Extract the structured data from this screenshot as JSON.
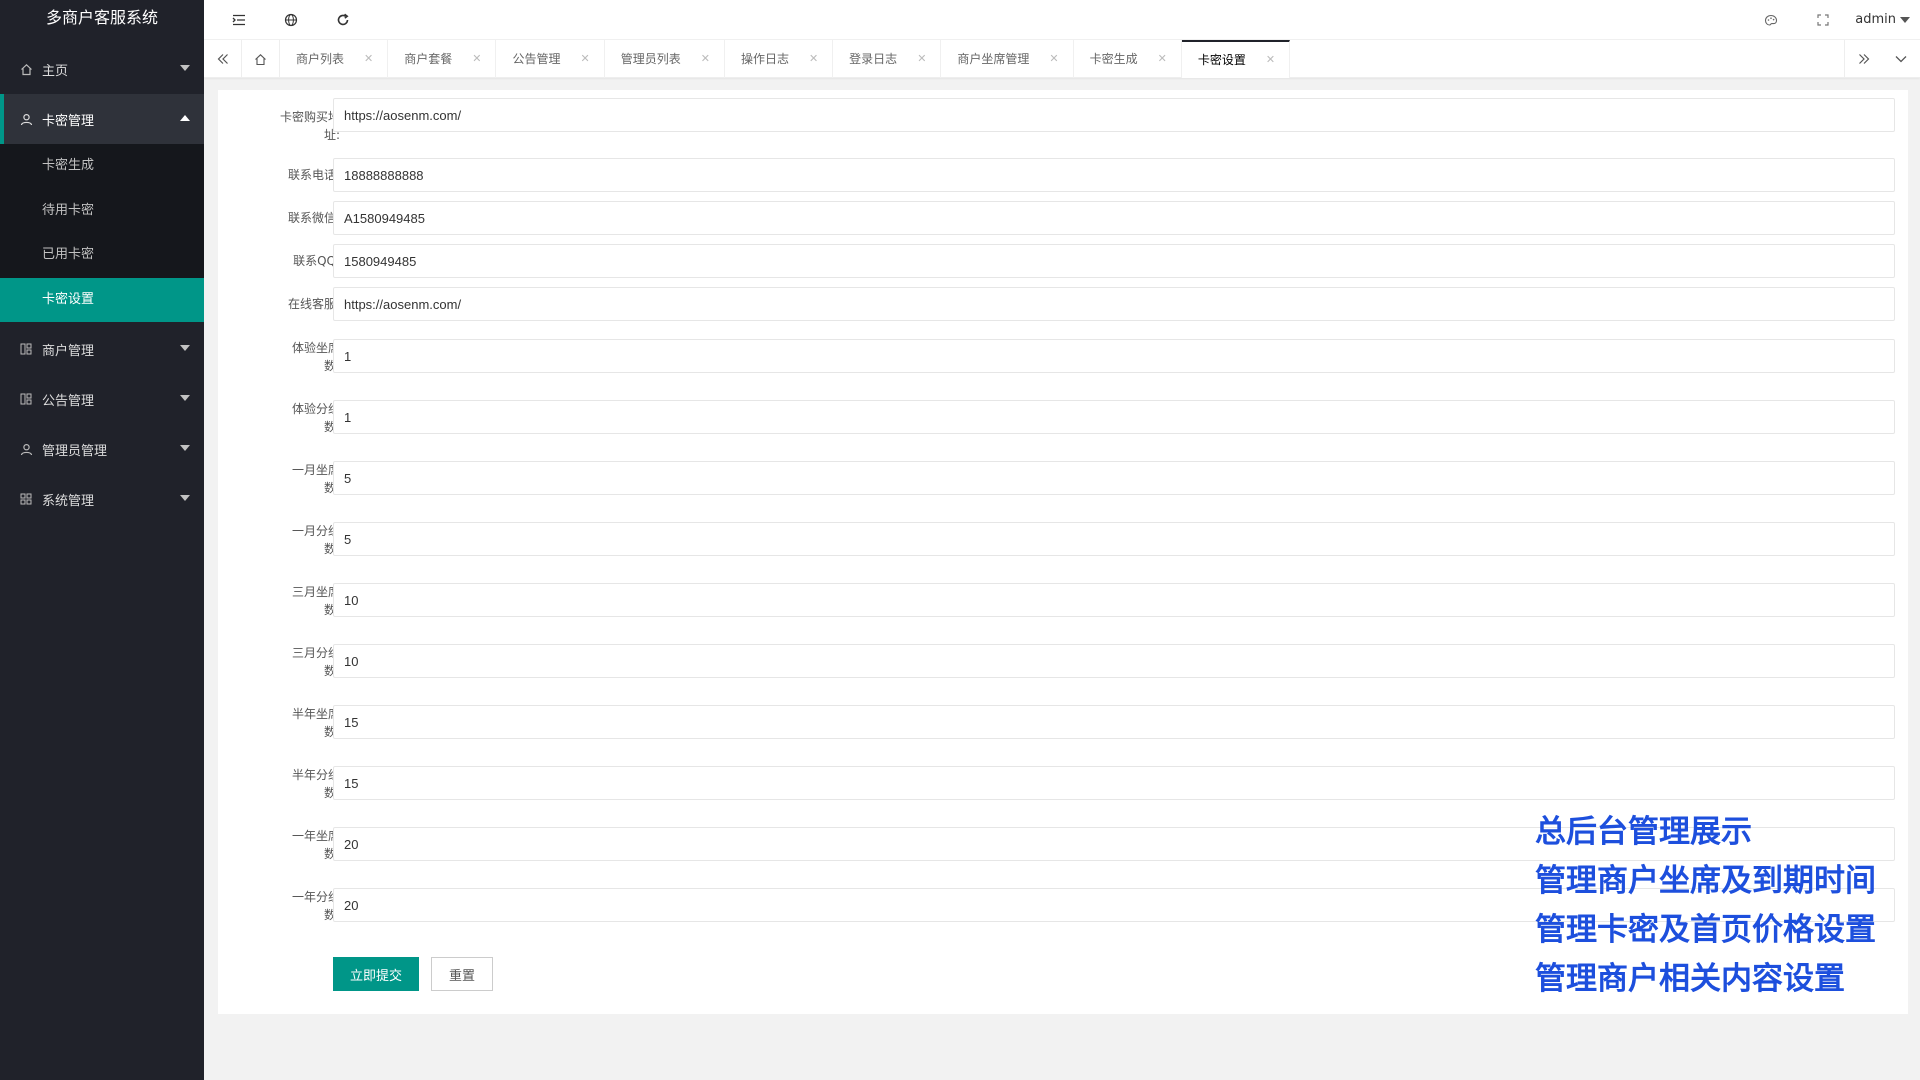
{
  "app": {
    "title": "多商户客服系统"
  },
  "sidebar": {
    "items": [
      {
        "label": "主页",
        "icon": "home-icon"
      },
      {
        "label": "卡密管理",
        "icon": "user-icon",
        "open": true,
        "children": [
          "卡密生成",
          "待用卡密",
          "已用卡密",
          "卡密设置"
        ]
      },
      {
        "label": "商户管理",
        "icon": "grid-icon"
      },
      {
        "label": "公告管理",
        "icon": "grid-icon"
      },
      {
        "label": "管理员管理",
        "icon": "user-icon"
      },
      {
        "label": "系统管理",
        "icon": "apps-icon"
      }
    ],
    "active_child": "卡密设置"
  },
  "header": {
    "user": "admin"
  },
  "tabs": [
    {
      "label": "商户列表"
    },
    {
      "label": "商户套餐"
    },
    {
      "label": "公告管理"
    },
    {
      "label": "管理员列表"
    },
    {
      "label": "操作日志"
    },
    {
      "label": "登录日志"
    },
    {
      "label": "商户坐席管理"
    },
    {
      "label": "卡密生成"
    },
    {
      "label": "卡密设置",
      "active": true
    }
  ],
  "form": {
    "fields": [
      {
        "label1": "卡密购买地",
        "label2": "址:",
        "value": "https://aosenm.com/"
      },
      {
        "label1": "联系电话:",
        "label2": "",
        "value": "18888888888"
      },
      {
        "label1": "联系微信:",
        "label2": "",
        "value": "A1580949485"
      },
      {
        "label1": "联系QQ:",
        "label2": "",
        "value": "1580949485"
      },
      {
        "label1": "在线客服:",
        "label2": "",
        "value": "https://aosenm.com/"
      },
      {
        "label1": "体验坐席",
        "label2": "数:",
        "value": "1"
      },
      {
        "label1": "体验分组",
        "label2": "数:",
        "value": "1"
      },
      {
        "label1": "一月坐席",
        "label2": "数:",
        "value": "5"
      },
      {
        "label1": "一月分组",
        "label2": "数:",
        "value": "5"
      },
      {
        "label1": "三月坐席",
        "label2": "数:",
        "value": "10"
      },
      {
        "label1": "三月分组",
        "label2": "数:",
        "value": "10"
      },
      {
        "label1": "半年坐席",
        "label2": "数:",
        "value": "15"
      },
      {
        "label1": "半年分组",
        "label2": "数:",
        "value": "15"
      },
      {
        "label1": "一年坐席",
        "label2": "数:",
        "value": "20"
      },
      {
        "label1": "一年分组",
        "label2": "数:",
        "value": "20"
      }
    ],
    "submit_label": "立即提交",
    "reset_label": "重置"
  },
  "overlay": {
    "lines": [
      "总后台管理展示",
      "管理商户坐席及到期时间",
      "管理卡密及首页价格设置",
      "管理商户相关内容设置"
    ],
    "color": "#1d4fdd"
  },
  "colors": {
    "accent": "#009688",
    "sidebar_bg": "#20222a"
  }
}
